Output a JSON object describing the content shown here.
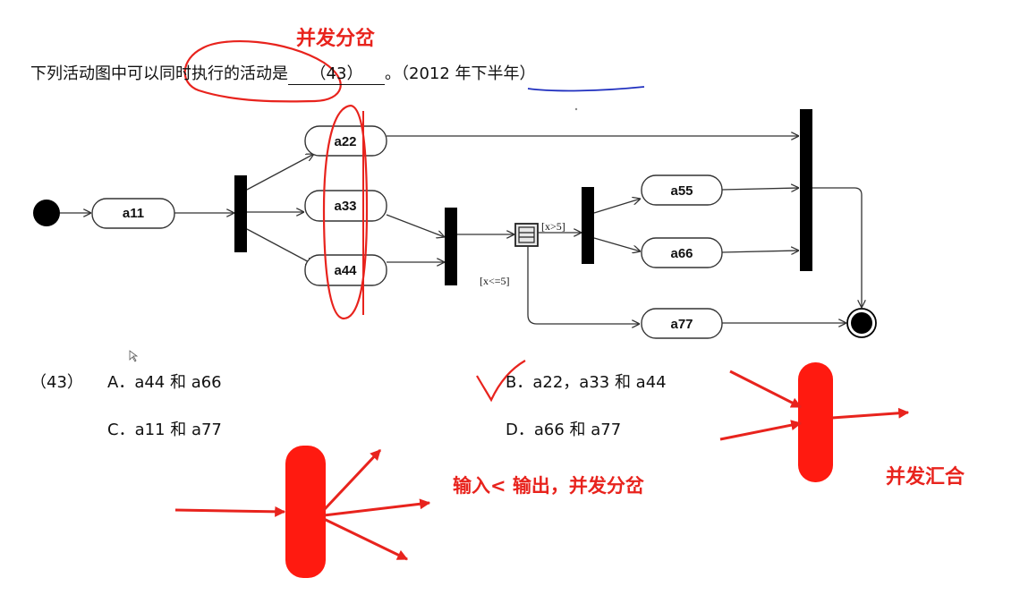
{
  "question": {
    "text_before": "下列活动图中可以同时执行的活动是",
    "blank": "（43）",
    "text_after": "。",
    "source": "（2012 年下半年）"
  },
  "diagram": {
    "activities": {
      "a11": "a11",
      "a22": "a22",
      "a33": "a33",
      "a44": "a44",
      "a55": "a55",
      "a66": "a66",
      "a77": "a77"
    },
    "guards": {
      "gt": "[x>5]",
      "le": "[x<=5]"
    }
  },
  "options": {
    "number": "（43）",
    "A": "A．a44 和 a66",
    "B": "B．a22，a33 和 a44",
    "C": "C．a11 和 a77",
    "D": "D．a66 和 a77"
  },
  "annotations": {
    "fork_title": "并发分岔",
    "fork_explain": "输入< 输出，并发分岔",
    "join_title": "并发汇合",
    "ink_color": "#e8231d",
    "underline_color": "#1f2fbf"
  }
}
